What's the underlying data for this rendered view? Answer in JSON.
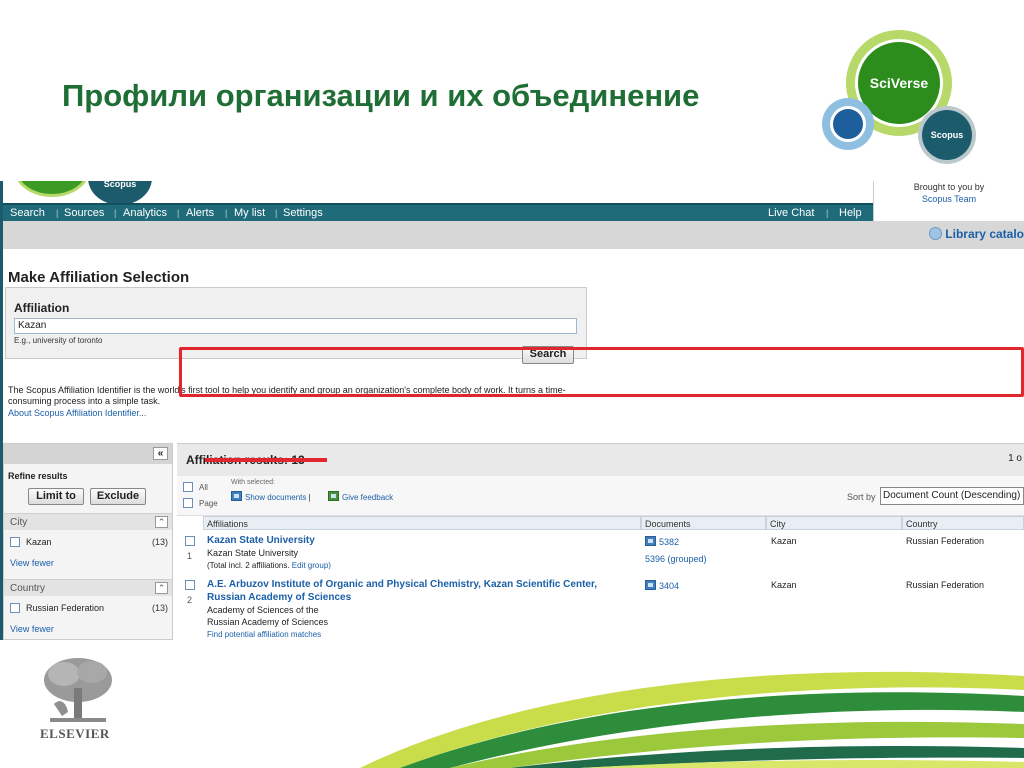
{
  "slide": {
    "title": "Профили организации и их объединение",
    "logo_sciverse": "SciVerse",
    "logo_scopus": "Scopus",
    "elsevier": "ELSEVIER"
  },
  "scopus": {
    "mini_logo": "Scopus",
    "brought_by": "Brought to you by",
    "brought_team": "Scopus Team",
    "nav": {
      "search": "Search",
      "sources": "Sources",
      "analytics": "Analytics",
      "alerts": "Alerts",
      "my_list": "My list",
      "settings": "Settings",
      "live_chat": "Live Chat",
      "help": "Help"
    },
    "library_catalog": "Library catalo",
    "page_title": "Make Affiliation Selection",
    "affiliation_label": "Affiliation",
    "affiliation_value": "Kazan",
    "affiliation_example": "E.g., university of toronto",
    "search_button": "Search",
    "description": "The Scopus Affiliation Identifier is the world's first tool to help you identify and group an organization's complete body of work. It turns a time-consuming process into a simple task.",
    "about_link": "About Scopus Affiliation Identifier...",
    "refine": {
      "collapse": "«",
      "title": "Refine results",
      "limit_to": "Limit to",
      "exclude": "Exclude",
      "city_header": "City",
      "city_item": "Kazan",
      "city_count": "(13)",
      "country_header": "Country",
      "country_item": "Russian Federation",
      "country_count": "(13)",
      "view_fewer": "View fewer"
    },
    "results": {
      "title": "Affiliation results: 13",
      "page": "1 o",
      "all": "All",
      "page_label": "Page",
      "with_selected": "With selected:",
      "show_documents": "Show documents",
      "give_feedback": "Give feedback",
      "sort_by": "Sort by",
      "sort_value": "Document Count (Descending)",
      "columns": {
        "affiliations": "Affiliations",
        "documents": "Documents",
        "city": "City",
        "country": "Country"
      },
      "rows": [
        {
          "no": "1",
          "name": "Kazan State University",
          "sub": "Kazan State University",
          "total": "(Total incl. 2 affiliations.",
          "edit_group": "Edit group)",
          "documents": "5382",
          "grouped": "5396 (grouped)",
          "city": "Kazan",
          "country": "Russian Federation"
        },
        {
          "no": "2",
          "name_line1": "A.E. Arbuzov Institute of Organic and Physical Chemistry, Kazan Scientific Center,",
          "name_line2": "Russian Academy of Sciences",
          "sub1": "Academy of Sciences of the",
          "sub2": "Russian Academy of Sciences",
          "find_matches": "Find potential affiliation matches",
          "documents": "3404",
          "city": "Kazan",
          "country": "Russian Federation"
        }
      ]
    }
  },
  "colors": {
    "title_green": "#1f6e35",
    "nav_teal": "#1f6b7a",
    "link_blue": "#1b5fa8",
    "highlight_red": "#e3262d"
  }
}
